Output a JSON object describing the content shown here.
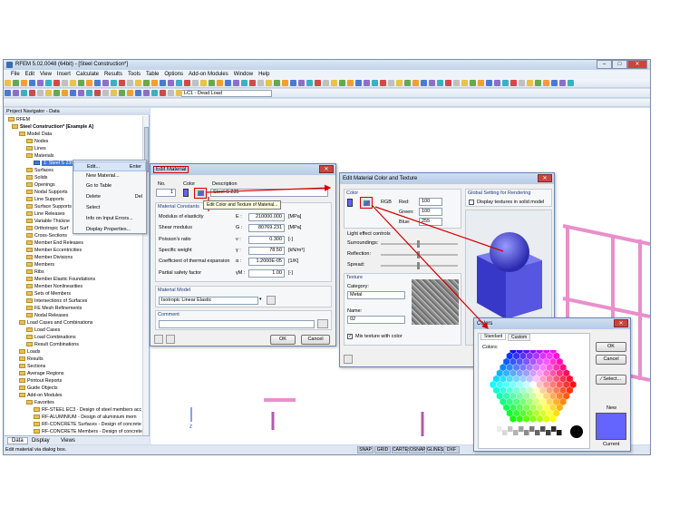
{
  "window": {
    "title": "RFEM 5.02.0048 (64bit) - [Steel Construction*]"
  },
  "menu": [
    "File",
    "Edit",
    "View",
    "Insert",
    "Calculate",
    "Results",
    "Tools",
    "Table",
    "Options",
    "Add-on Modules",
    "Window",
    "Help"
  ],
  "toolbar": {
    "load_case": "LC1 - Dead Load"
  },
  "navigator": {
    "title": "Project Navigator - Data",
    "items": [
      "RFEM",
      "Steel Construction* [Example A]",
      "Model Data",
      "Nodes",
      "Lines",
      "Materials",
      "1: Steel S 235",
      "Surfaces",
      "Solids",
      "Openings",
      "Nodal Supports",
      "Line Supports",
      "Surface Supports",
      "Line Releases",
      "Variable Thickne",
      "Orthotropic Surf",
      "Cross-Sections",
      "Member End Releases",
      "Member Eccentricities",
      "Member Divisions",
      "Members",
      "Ribs",
      "Member Elastic Foundations",
      "Member Nonlinearities",
      "Sets of Members",
      "Intersections of Surfaces",
      "FE Mesh Refinements",
      "Nodal Releases",
      "Load Cases and Combinations",
      "Load Cases",
      "Load Combinations",
      "Result Combinations",
      "Loads",
      "Results",
      "Sections",
      "Average Regions",
      "Printout Reports",
      "Guide Objects",
      "Add-on Modules",
      "Favorites",
      "RF-STEEL EC3 - Design of steel members acc",
      "RF-ALUMINIUM - Design of aluminium mem",
      "RF-CONCRETE Surfaces - Design of concrete",
      "RF-CONCRETE Members - Design of concrete"
    ],
    "tabs": [
      "Data",
      "Display",
      "Views"
    ]
  },
  "context_menu": {
    "items": [
      "Edit...",
      "New Material...",
      "Go to Table",
      "Delete",
      "Select",
      "Info on Input Errors...",
      "Display Properties..."
    ],
    "edit_shortcut": "Enter",
    "delete_shortcut": "Del"
  },
  "status": {
    "text": "Edit material via dialog box.",
    "buttons": [
      "SNAP",
      "GRID",
      "CARTES",
      "OSNAP",
      "GLINES",
      "DXF"
    ]
  },
  "edit_material": {
    "title": "Edit Material",
    "no_label": "No.",
    "no": "1",
    "color_label": "Color",
    "desc_label": "Description",
    "desc": "Steel S 235",
    "tooltip": "Edit Color and Texture of Material...",
    "constants_title": "Material Constants",
    "rows": [
      [
        "Modulus of elasticity",
        "E :",
        "210000.000",
        "[MPa]"
      ],
      [
        "Shear modulus",
        "G :",
        "80769.231",
        "[MPa]"
      ],
      [
        "Poisson's ratio",
        "ν :",
        "0.300",
        "[-]"
      ],
      [
        "Specific weight",
        "γ :",
        "78.50",
        "[kN/m³]"
      ],
      [
        "Coefficient of thermal expansion",
        "α :",
        "1.2000E-05",
        "[1/K]"
      ],
      [
        "Partial safety factor",
        "γM :",
        "1.00",
        "[-]"
      ]
    ],
    "model_title": "Material Model",
    "model": "Isotropic Linear Elastic",
    "comment_title": "Comment",
    "ok": "OK",
    "cancel": "Cancel"
  },
  "color_texture": {
    "title": "Edit Material Color and Texture",
    "color_title": "Color",
    "rgb_label": "RGB",
    "red_label": "Red:",
    "red": "100",
    "green_label": "Green:",
    "green": "100",
    "blue_label": "Blue:",
    "blue": "255",
    "light_title": "Light effect controls",
    "surroundings": "Surroundings:",
    "reflection": "Reflection:",
    "spread": "Spread:",
    "texture_title": "Texture",
    "category_label": "Category:",
    "category": "Metal",
    "name_label": "Name:",
    "name": "02",
    "mix_label": "Mix texture with color",
    "global_title": "Global Setting for Rendering",
    "display_textures": "Display textures in solid model",
    "material_color": "#6464ff"
  },
  "colors": {
    "title": "Colors",
    "tab_standard": "Standard",
    "tab_custom": "Custom",
    "colors_label": "Colors:",
    "ok": "OK",
    "cancel": "Cancel",
    "select": "Select...",
    "new_label": "New",
    "current_label": "Current"
  }
}
